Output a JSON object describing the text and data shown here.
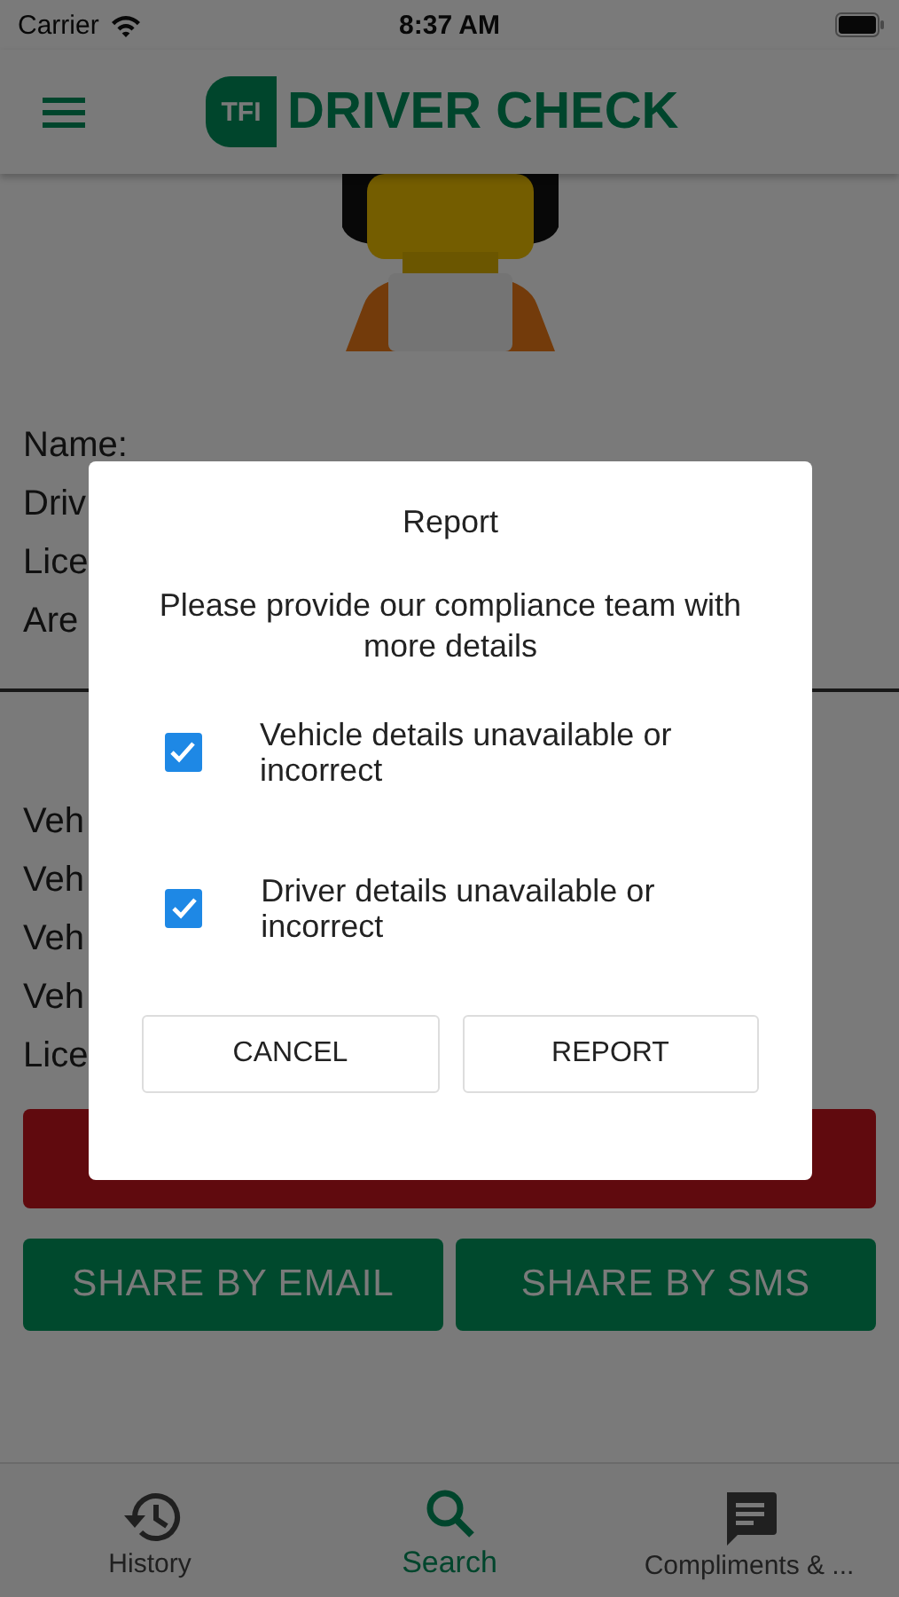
{
  "status_bar": {
    "carrier": "Carrier",
    "time": "8:37 AM"
  },
  "header": {
    "logo_mark": "TFI",
    "title": "DRIVER CHECK"
  },
  "driver_fields": [
    "Name:",
    "Driv",
    "Lice",
    "Are"
  ],
  "vehicle_fields": [
    "Veh",
    "Veh",
    "Veh",
    "Veh",
    "Lice"
  ],
  "share_buttons": [
    "SHARE BY EMAIL",
    "SHARE BY SMS"
  ],
  "tab_bar": [
    {
      "label": "History",
      "kind": "history",
      "selected": false
    },
    {
      "label": "Search",
      "kind": "search",
      "selected": true
    },
    {
      "label": "Compliments & ...",
      "kind": "chat",
      "selected": false
    }
  ],
  "dialog": {
    "title": "Report",
    "message": "Please provide our compliance team with more details",
    "options": [
      {
        "label": "Vehicle details unavailable or incorrect",
        "checked": true
      },
      {
        "label": "Driver details unavailable or incorrect",
        "checked": true
      }
    ],
    "buttons": [
      "CANCEL",
      "REPORT"
    ]
  }
}
